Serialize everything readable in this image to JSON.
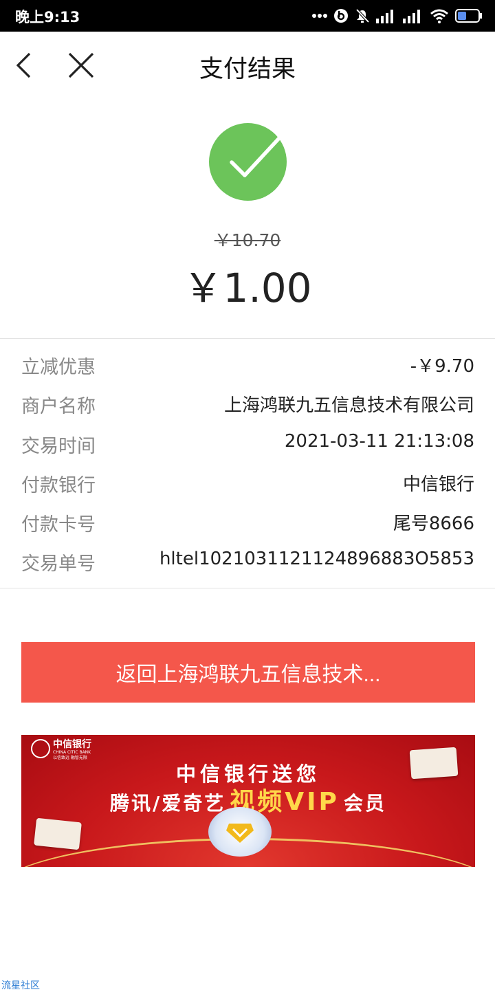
{
  "status_bar": {
    "time": "晚上9:13",
    "icons": [
      "more-dots-icon",
      "beats-icon",
      "mute-icon",
      "signal-1-icon",
      "signal-2-icon",
      "wifi-icon",
      "battery-icon"
    ]
  },
  "nav": {
    "title": "支付结果",
    "back_icon": "chevron-left-icon",
    "close_icon": "close-icon"
  },
  "result": {
    "icon": "success-check-icon",
    "icon_color": "#6cc45a",
    "original_price": "￥10.70",
    "paid_amount": "￥1.00"
  },
  "details": [
    {
      "label": "立减优惠",
      "value": "-￥9.70"
    },
    {
      "label": "商户名称",
      "value": "上海鸿联九五信息技术有限公司"
    },
    {
      "label": "交易时间",
      "value": "2021-03-11 21:13:08"
    },
    {
      "label": "付款银行",
      "value": "中信银行"
    },
    {
      "label": "付款卡号",
      "value": "尾号8666"
    },
    {
      "label": "交易单号",
      "value": "hltel1021031121124896883O5853"
    }
  ],
  "return_button": {
    "label": "返回上海鸿联九五信息技术...",
    "color": "#f4574b"
  },
  "banner": {
    "bank_name": "中信银行",
    "bank_name_en": "CHINA CITIC BANK",
    "slogan": "以信致远 融智无限",
    "line1": "中信银行送您",
    "line2_prefix": "腾讯/爱奇艺",
    "line2_highlight": "视频VIP",
    "line2_suffix": "会员"
  },
  "watermark": "流星社区"
}
